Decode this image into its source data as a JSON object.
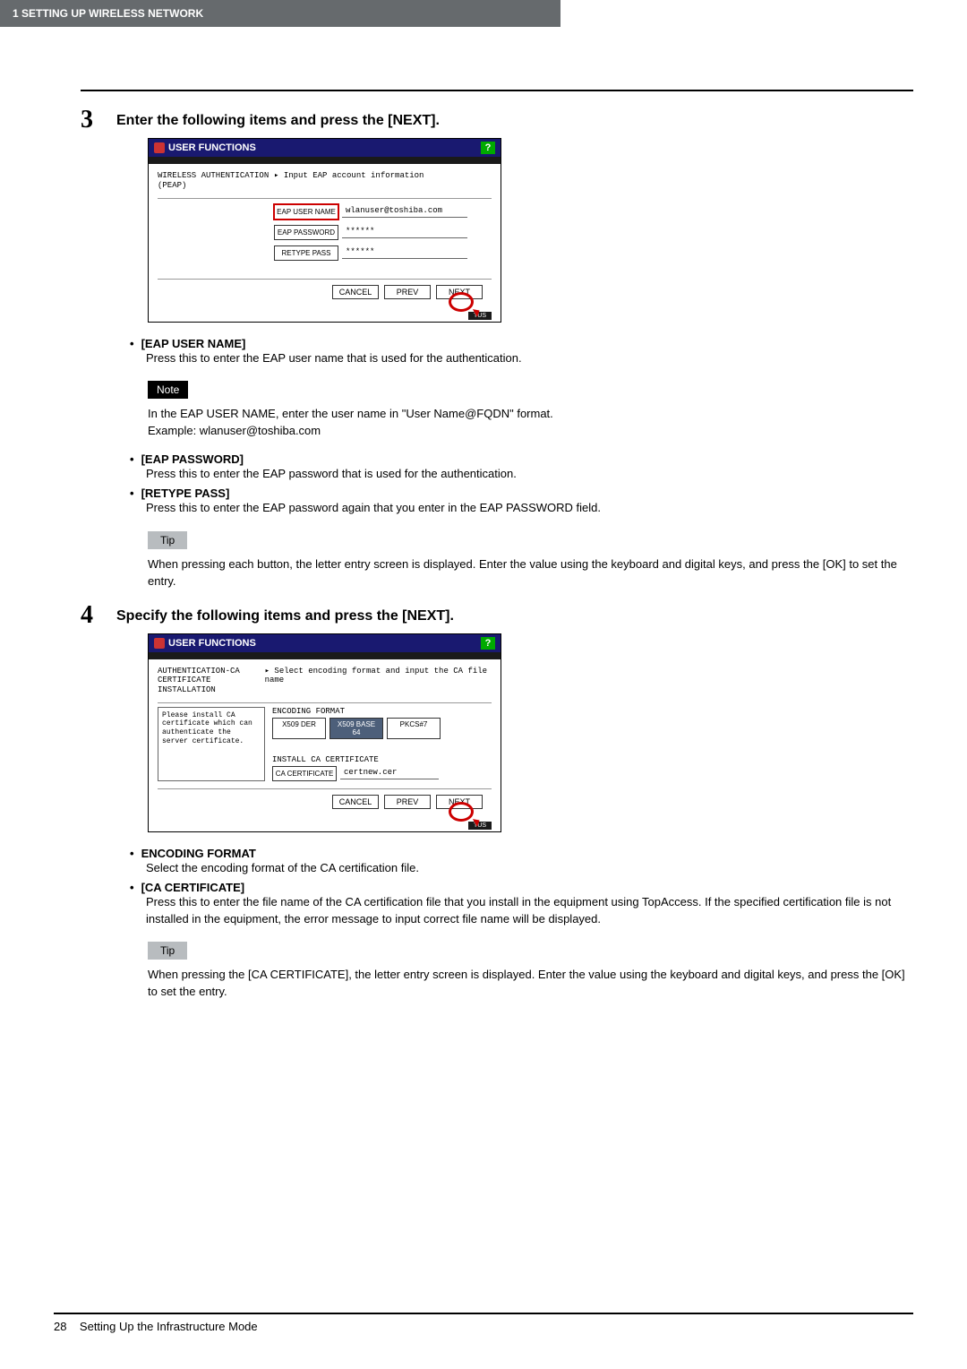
{
  "header": {
    "section": "1 SETTING UP WIRELESS NETWORK"
  },
  "step3": {
    "num": "3",
    "title": "Enter the following items and press the [NEXT].",
    "ss": {
      "title": "USER FUNCTIONS",
      "help": "?",
      "leftLabel": "WIRELESS AUTHENTICATION (PEAP)",
      "rightLabel": "▸ Input EAP account information",
      "fields": {
        "userNameBtn": "EAP USER NAME",
        "userNameVal": "wlanuser@toshiba.com",
        "passBtn": "EAP PASSWORD",
        "passVal": "******",
        "retypeBtn": "RETYPE PASS",
        "retypeVal": "******"
      },
      "buttons": {
        "cancel": "CANCEL",
        "prev": "PREV",
        "next": "NEXT"
      },
      "status": "TUS"
    },
    "items": {
      "eapUserName": {
        "title": "[EAP USER NAME]",
        "desc": "Press this to enter the EAP user name that is used for the authentication."
      },
      "noteLabel": "Note",
      "noteText1": "In the EAP USER NAME, enter the user name in \"User Name@FQDN\" format.",
      "noteText2": "Example: wlanuser@toshiba.com",
      "eapPassword": {
        "title": "[EAP PASSWORD]",
        "desc": "Press this to enter the EAP password that is used for the authentication."
      },
      "retypePass": {
        "title": "[RETYPE PASS]",
        "desc": "Press this to enter the EAP password again that you enter in the EAP PASSWORD field."
      },
      "tipLabel": "Tip",
      "tipText": "When pressing each button, the letter entry screen is displayed. Enter the value using the keyboard and digital keys, and press the [OK] to set the entry."
    }
  },
  "step4": {
    "num": "4",
    "title": "Specify the following items and press the [NEXT].",
    "ss": {
      "title": "USER FUNCTIONS",
      "help": "?",
      "leftLabel": "AUTHENTICATION-CA CERTIFICATE INSTALLATION",
      "rightLabel": "▸ Select encoding format and input the CA file name",
      "leftBox": "Please install CA certificate which can authenticate the server certificate.",
      "encLabel": "ENCODING FORMAT",
      "enc": {
        "x509der": "X509 DER",
        "x509b64": "X509 BASE 64",
        "pkcs7": "PKCS#7"
      },
      "installLabel": "INSTALL CA CERTIFICATE",
      "caBtn": "CA CERTIFICATE",
      "caVal": "certnew.cer",
      "buttons": {
        "cancel": "CANCEL",
        "prev": "PREV",
        "next": "NEXT"
      },
      "status": "TUS"
    },
    "items": {
      "encoding": {
        "title": "ENCODING FORMAT",
        "desc": "Select the encoding format of the CA certification file."
      },
      "caCert": {
        "title": "[CA CERTIFICATE]",
        "desc": "Press this to enter the file name of the CA certification file that you install in the equipment using TopAccess.  If the specified certification file is not installed in the equipment, the error message to input correct file name will be displayed."
      },
      "tipLabel": "Tip",
      "tipText": "When pressing the [CA CERTIFICATE], the letter entry screen is displayed. Enter the value using the keyboard and digital keys, and press the [OK] to set the entry."
    }
  },
  "footer": {
    "page": "28",
    "title": "Setting Up the Infrastructure Mode"
  }
}
